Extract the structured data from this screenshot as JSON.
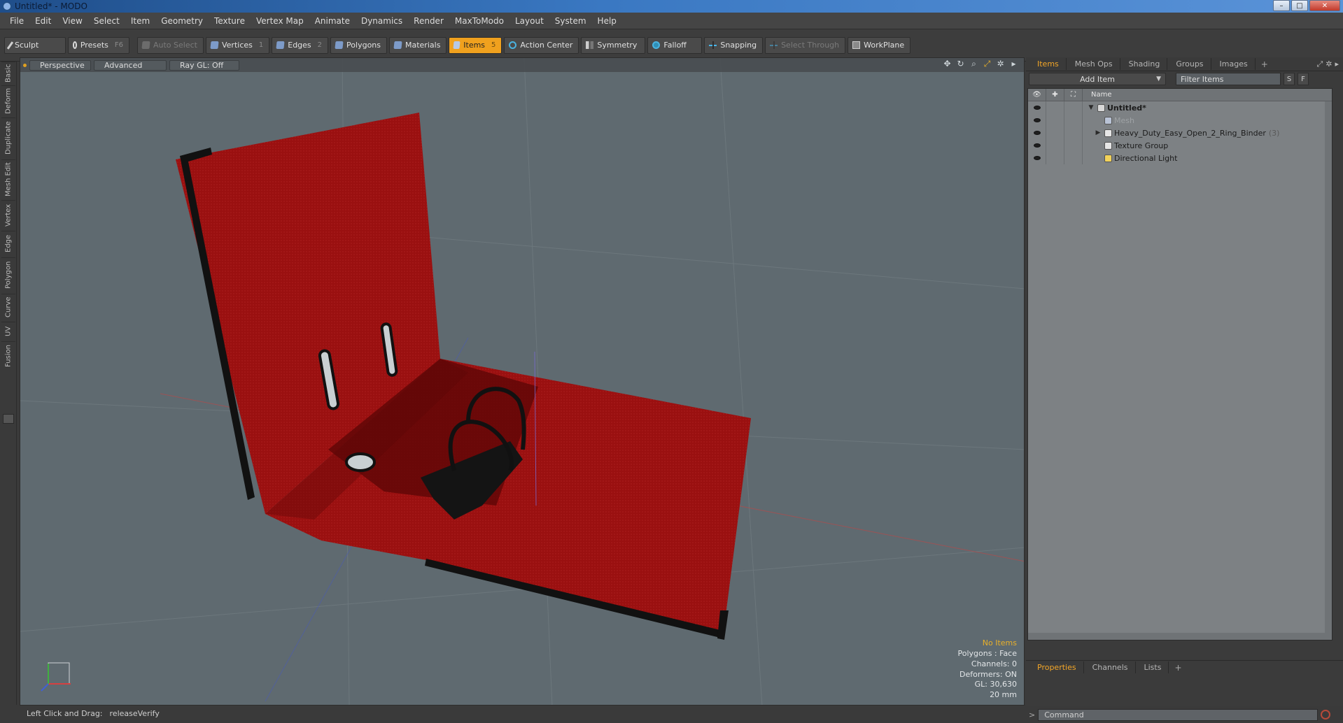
{
  "window": {
    "title": "Untitled* - MODO",
    "controls": [
      "–",
      "□",
      "✕"
    ]
  },
  "menu": [
    "File",
    "Edit",
    "View",
    "Select",
    "Item",
    "Geometry",
    "Texture",
    "Vertex Map",
    "Animate",
    "Dynamics",
    "Render",
    "MaxToModo",
    "Layout",
    "System",
    "Help"
  ],
  "toolbar": {
    "sculpt": "Sculpt",
    "presets": "Presets",
    "presets_key": "F6",
    "auto_select": "Auto Select",
    "vertices": "Vertices",
    "vertices_count": "1",
    "edges": "Edges",
    "edges_count": "2",
    "polygons": "Polygons",
    "materials": "Materials",
    "items": "Items",
    "items_count": "5",
    "action_center": "Action Center",
    "symmetry": "Symmetry",
    "falloff": "Falloff",
    "snapping": "Snapping",
    "select_through": "Select Through",
    "workplane": "WorkPlane"
  },
  "left_tabs": [
    "Basic",
    "Deform",
    "Duplicate",
    "Mesh Edit",
    "Vertex",
    "Edge",
    "Polygon",
    "Curve",
    "UV",
    "Fusion"
  ],
  "viewport": {
    "view_mode": "Perspective",
    "shading": "Advanced",
    "raygl": "Ray GL: Off",
    "stats": {
      "no_items": "No Items",
      "polygons": "Polygons : Face",
      "channels": "Channels: 0",
      "deformers": "Deformers: ON",
      "gl": "GL: 30,630",
      "scale": "20 mm"
    },
    "colors": {
      "background": "#5f6a70",
      "binder_red": "#9a1010",
      "binder_dark": "#5a0606",
      "metal": "#111111"
    }
  },
  "statusbar": {
    "hint_label": "Left Click and Drag:",
    "hint_value": "releaseVerify"
  },
  "right_panel": {
    "tabs": [
      "Items",
      "Mesh Ops",
      "Shading",
      "Groups",
      "Images"
    ],
    "add_item": "Add Item",
    "filter_placeholder": "Filter Items",
    "s_btn": "S",
    "f_btn": "F",
    "column_name": "Name",
    "tree": [
      {
        "label": "Untitled*",
        "sub": "",
        "level": 0,
        "twisty": "▼",
        "icon": "scene-icon",
        "bold": true,
        "dim": false,
        "eye": true
      },
      {
        "label": "Mesh",
        "sub": "",
        "level": 1,
        "twisty": "",
        "icon": "mesh-icon",
        "bold": false,
        "dim": true,
        "eye": true
      },
      {
        "label": "Heavy_Duty_Easy_Open_2_Ring_Binder",
        "sub": "(3)",
        "level": 1,
        "twisty": "▶",
        "icon": "group-icon",
        "bold": false,
        "dim": false,
        "eye": true
      },
      {
        "label": "Texture Group",
        "sub": "",
        "level": 1,
        "twisty": "",
        "icon": "texture-group-icon",
        "bold": false,
        "dim": false,
        "eye": true
      },
      {
        "label": "Directional Light",
        "sub": "",
        "level": 1,
        "twisty": "",
        "icon": "light-icon",
        "bold": false,
        "dim": false,
        "eye": true
      }
    ],
    "props_tabs": [
      "Properties",
      "Channels",
      "Lists"
    ],
    "command_placeholder": "Command"
  }
}
